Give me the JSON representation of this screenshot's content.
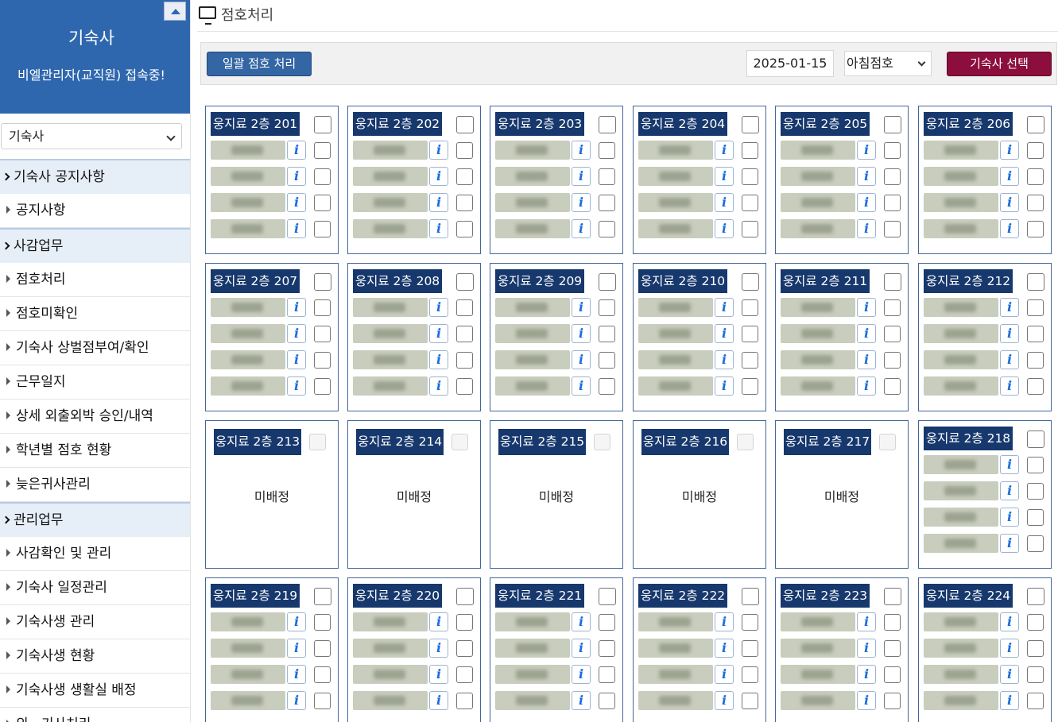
{
  "sidebar": {
    "title": "기숙사",
    "user_status": "비엘관리자(교직원) 접속중!",
    "selector_value": "기숙사",
    "groups": [
      {
        "label": "기숙사 공지사항",
        "items": [
          "공지사항"
        ]
      },
      {
        "label": "사감업무",
        "items": [
          "점호처리",
          "점호미확인",
          "기숙사 상벌점부여/확인",
          "근무일지",
          "상세 외출외박 승인/내역",
          "학년별 점호 현황",
          "늦은귀사관리"
        ]
      },
      {
        "label": "관리업무",
        "items": [
          "사감확인 및 관리",
          "기숙사 일정관리",
          "기숙사생 관리",
          "기숙사생 현황",
          "기숙사생 생활실 배정",
          "외···기사처리"
        ]
      }
    ]
  },
  "header": {
    "title": "점호처리"
  },
  "toolbar": {
    "bulk_button": "일괄 점호 처리",
    "date": "2025-01-15",
    "rollcall_type": "아침점호",
    "select_dorm_button": "기숙사 선택"
  },
  "rooms": [
    {
      "name": "웅지료 2층 201",
      "assigned": true,
      "students": 4
    },
    {
      "name": "웅지료 2층 202",
      "assigned": true,
      "students": 4
    },
    {
      "name": "웅지료 2층 203",
      "assigned": true,
      "students": 4
    },
    {
      "name": "웅지료 2층 204",
      "assigned": true,
      "students": 4
    },
    {
      "name": "웅지료 2층 205",
      "assigned": true,
      "students": 4
    },
    {
      "name": "웅지료 2층 206",
      "assigned": true,
      "students": 4
    },
    {
      "name": "웅지료 2층 207",
      "assigned": true,
      "students": 4
    },
    {
      "name": "웅지료 2층 208",
      "assigned": true,
      "students": 4
    },
    {
      "name": "웅지료 2층 209",
      "assigned": true,
      "students": 4
    },
    {
      "name": "웅지료 2층 210",
      "assigned": true,
      "students": 4
    },
    {
      "name": "웅지료 2층 211",
      "assigned": true,
      "students": 4
    },
    {
      "name": "웅지료 2층 212",
      "assigned": true,
      "students": 4
    },
    {
      "name": "웅지료 2층 213",
      "assigned": false,
      "status": "미배정"
    },
    {
      "name": "웅지료 2층 214",
      "assigned": false,
      "status": "미배정"
    },
    {
      "name": "웅지료 2층 215",
      "assigned": false,
      "status": "미배정"
    },
    {
      "name": "웅지료 2층 216",
      "assigned": false,
      "status": "미배정"
    },
    {
      "name": "웅지료 2층 217",
      "assigned": false,
      "status": "미배정"
    },
    {
      "name": "웅지료 2층 218",
      "assigned": true,
      "students": 4
    },
    {
      "name": "웅지료 2층 219",
      "assigned": true,
      "students": 4
    },
    {
      "name": "웅지료 2층 220",
      "assigned": true,
      "students": 4
    },
    {
      "name": "웅지료 2층 221",
      "assigned": true,
      "students": 4
    },
    {
      "name": "웅지료 2층 222",
      "assigned": true,
      "students": 4
    },
    {
      "name": "웅지료 2층 223",
      "assigned": true,
      "students": 4
    },
    {
      "name": "웅지료 2층 224",
      "assigned": true,
      "students": 4
    }
  ],
  "icons": {
    "collapse": "chevron-up-icon",
    "monitor": "monitor-icon",
    "info": "info-icon"
  },
  "colors": {
    "sidebar_header": "#2e67ad",
    "room_title": "#17386d",
    "primary_button": "#3366a3",
    "dorm_button": "#8b0e3c",
    "info_icon": "#1a6ddc"
  }
}
